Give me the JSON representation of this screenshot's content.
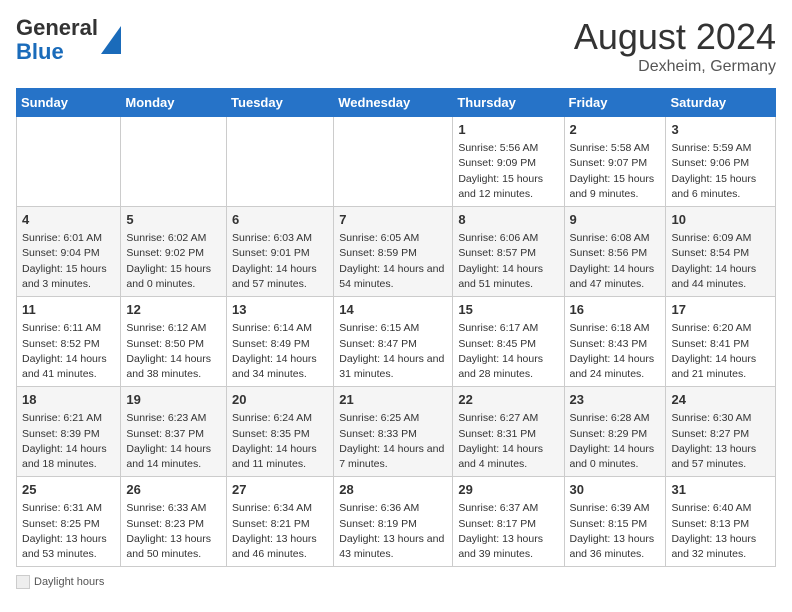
{
  "header": {
    "logo_line1": "General",
    "logo_line2": "Blue",
    "month_title": "August 2024",
    "location": "Dexheim, Germany"
  },
  "days_of_week": [
    "Sunday",
    "Monday",
    "Tuesday",
    "Wednesday",
    "Thursday",
    "Friday",
    "Saturday"
  ],
  "weeks": [
    [
      {
        "num": "",
        "info": ""
      },
      {
        "num": "",
        "info": ""
      },
      {
        "num": "",
        "info": ""
      },
      {
        "num": "",
        "info": ""
      },
      {
        "num": "1",
        "info": "Sunrise: 5:56 AM\nSunset: 9:09 PM\nDaylight: 15 hours and 12 minutes."
      },
      {
        "num": "2",
        "info": "Sunrise: 5:58 AM\nSunset: 9:07 PM\nDaylight: 15 hours and 9 minutes."
      },
      {
        "num": "3",
        "info": "Sunrise: 5:59 AM\nSunset: 9:06 PM\nDaylight: 15 hours and 6 minutes."
      }
    ],
    [
      {
        "num": "4",
        "info": "Sunrise: 6:01 AM\nSunset: 9:04 PM\nDaylight: 15 hours and 3 minutes."
      },
      {
        "num": "5",
        "info": "Sunrise: 6:02 AM\nSunset: 9:02 PM\nDaylight: 15 hours and 0 minutes."
      },
      {
        "num": "6",
        "info": "Sunrise: 6:03 AM\nSunset: 9:01 PM\nDaylight: 14 hours and 57 minutes."
      },
      {
        "num": "7",
        "info": "Sunrise: 6:05 AM\nSunset: 8:59 PM\nDaylight: 14 hours and 54 minutes."
      },
      {
        "num": "8",
        "info": "Sunrise: 6:06 AM\nSunset: 8:57 PM\nDaylight: 14 hours and 51 minutes."
      },
      {
        "num": "9",
        "info": "Sunrise: 6:08 AM\nSunset: 8:56 PM\nDaylight: 14 hours and 47 minutes."
      },
      {
        "num": "10",
        "info": "Sunrise: 6:09 AM\nSunset: 8:54 PM\nDaylight: 14 hours and 44 minutes."
      }
    ],
    [
      {
        "num": "11",
        "info": "Sunrise: 6:11 AM\nSunset: 8:52 PM\nDaylight: 14 hours and 41 minutes."
      },
      {
        "num": "12",
        "info": "Sunrise: 6:12 AM\nSunset: 8:50 PM\nDaylight: 14 hours and 38 minutes."
      },
      {
        "num": "13",
        "info": "Sunrise: 6:14 AM\nSunset: 8:49 PM\nDaylight: 14 hours and 34 minutes."
      },
      {
        "num": "14",
        "info": "Sunrise: 6:15 AM\nSunset: 8:47 PM\nDaylight: 14 hours and 31 minutes."
      },
      {
        "num": "15",
        "info": "Sunrise: 6:17 AM\nSunset: 8:45 PM\nDaylight: 14 hours and 28 minutes."
      },
      {
        "num": "16",
        "info": "Sunrise: 6:18 AM\nSunset: 8:43 PM\nDaylight: 14 hours and 24 minutes."
      },
      {
        "num": "17",
        "info": "Sunrise: 6:20 AM\nSunset: 8:41 PM\nDaylight: 14 hours and 21 minutes."
      }
    ],
    [
      {
        "num": "18",
        "info": "Sunrise: 6:21 AM\nSunset: 8:39 PM\nDaylight: 14 hours and 18 minutes."
      },
      {
        "num": "19",
        "info": "Sunrise: 6:23 AM\nSunset: 8:37 PM\nDaylight: 14 hours and 14 minutes."
      },
      {
        "num": "20",
        "info": "Sunrise: 6:24 AM\nSunset: 8:35 PM\nDaylight: 14 hours and 11 minutes."
      },
      {
        "num": "21",
        "info": "Sunrise: 6:25 AM\nSunset: 8:33 PM\nDaylight: 14 hours and 7 minutes."
      },
      {
        "num": "22",
        "info": "Sunrise: 6:27 AM\nSunset: 8:31 PM\nDaylight: 14 hours and 4 minutes."
      },
      {
        "num": "23",
        "info": "Sunrise: 6:28 AM\nSunset: 8:29 PM\nDaylight: 14 hours and 0 minutes."
      },
      {
        "num": "24",
        "info": "Sunrise: 6:30 AM\nSunset: 8:27 PM\nDaylight: 13 hours and 57 minutes."
      }
    ],
    [
      {
        "num": "25",
        "info": "Sunrise: 6:31 AM\nSunset: 8:25 PM\nDaylight: 13 hours and 53 minutes."
      },
      {
        "num": "26",
        "info": "Sunrise: 6:33 AM\nSunset: 8:23 PM\nDaylight: 13 hours and 50 minutes."
      },
      {
        "num": "27",
        "info": "Sunrise: 6:34 AM\nSunset: 8:21 PM\nDaylight: 13 hours and 46 minutes."
      },
      {
        "num": "28",
        "info": "Sunrise: 6:36 AM\nSunset: 8:19 PM\nDaylight: 13 hours and 43 minutes."
      },
      {
        "num": "29",
        "info": "Sunrise: 6:37 AM\nSunset: 8:17 PM\nDaylight: 13 hours and 39 minutes."
      },
      {
        "num": "30",
        "info": "Sunrise: 6:39 AM\nSunset: 8:15 PM\nDaylight: 13 hours and 36 minutes."
      },
      {
        "num": "31",
        "info": "Sunrise: 6:40 AM\nSunset: 8:13 PM\nDaylight: 13 hours and 32 minutes."
      }
    ]
  ],
  "legend": {
    "daylight_label": "Daylight hours"
  }
}
